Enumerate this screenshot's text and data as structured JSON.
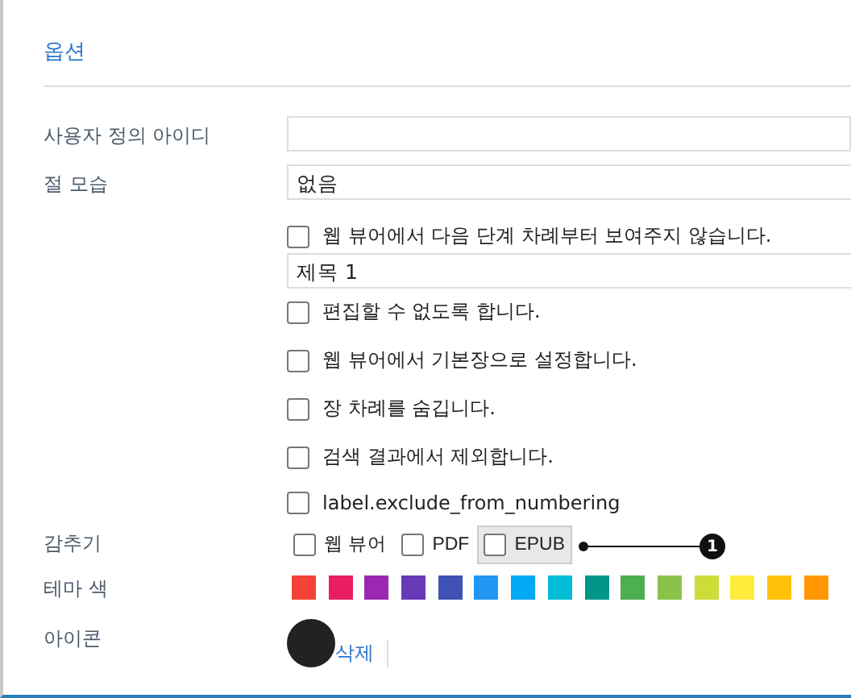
{
  "section_title": "옵션",
  "custom_id": {
    "label": "사용자 정의 아이디"
  },
  "section_style": {
    "label": "절 모습",
    "value": "없음"
  },
  "options": [
    {
      "kind": "checkbox",
      "label": "웹 뷰어에서 다음 단계 차례부터 보여주지 않습니다.",
      "checked": false
    },
    {
      "kind": "field",
      "value": "제목 1"
    },
    {
      "kind": "checkbox",
      "label": "편집할 수 없도록 합니다.",
      "checked": false
    },
    {
      "kind": "checkbox",
      "label": "웹 뷰어에서 기본장으로 설정합니다.",
      "checked": false
    },
    {
      "kind": "checkbox",
      "label": "장 차례를 숨깁니다.",
      "checked": false
    },
    {
      "kind": "checkbox",
      "label": "검색 결과에서 제외합니다.",
      "checked": false
    },
    {
      "kind": "checkbox",
      "label": "label.exclude_from_numbering",
      "checked": false
    }
  ],
  "hide": {
    "label": "감추기",
    "items": [
      {
        "label": "웹 뷰어",
        "checked": false,
        "focused": false
      },
      {
        "label": "PDF",
        "checked": false,
        "focused": false
      },
      {
        "label": "EPUB",
        "checked": false,
        "focused": true
      }
    ]
  },
  "callout": {
    "number": "1"
  },
  "theme_color": {
    "label": "테마 색",
    "swatches": [
      {
        "color": "#f44336"
      },
      {
        "color": "#e91e63"
      },
      {
        "color": "#9c27b0"
      },
      {
        "color": "#673ab7"
      },
      {
        "color": "#3f51b5"
      },
      {
        "color": "#2196f3"
      },
      {
        "color": "#03a9f4"
      },
      {
        "color": "#00bcd4"
      },
      {
        "color": "#009688"
      },
      {
        "color": "#4caf50"
      },
      {
        "color": "#8bc34a"
      },
      {
        "color": "#cddc39"
      },
      {
        "color": "#ffeb3b"
      },
      {
        "color": "#ffc107"
      },
      {
        "color": "#ff9800"
      }
    ]
  },
  "icon": {
    "label": "아이콘",
    "delete_link": "삭제"
  }
}
